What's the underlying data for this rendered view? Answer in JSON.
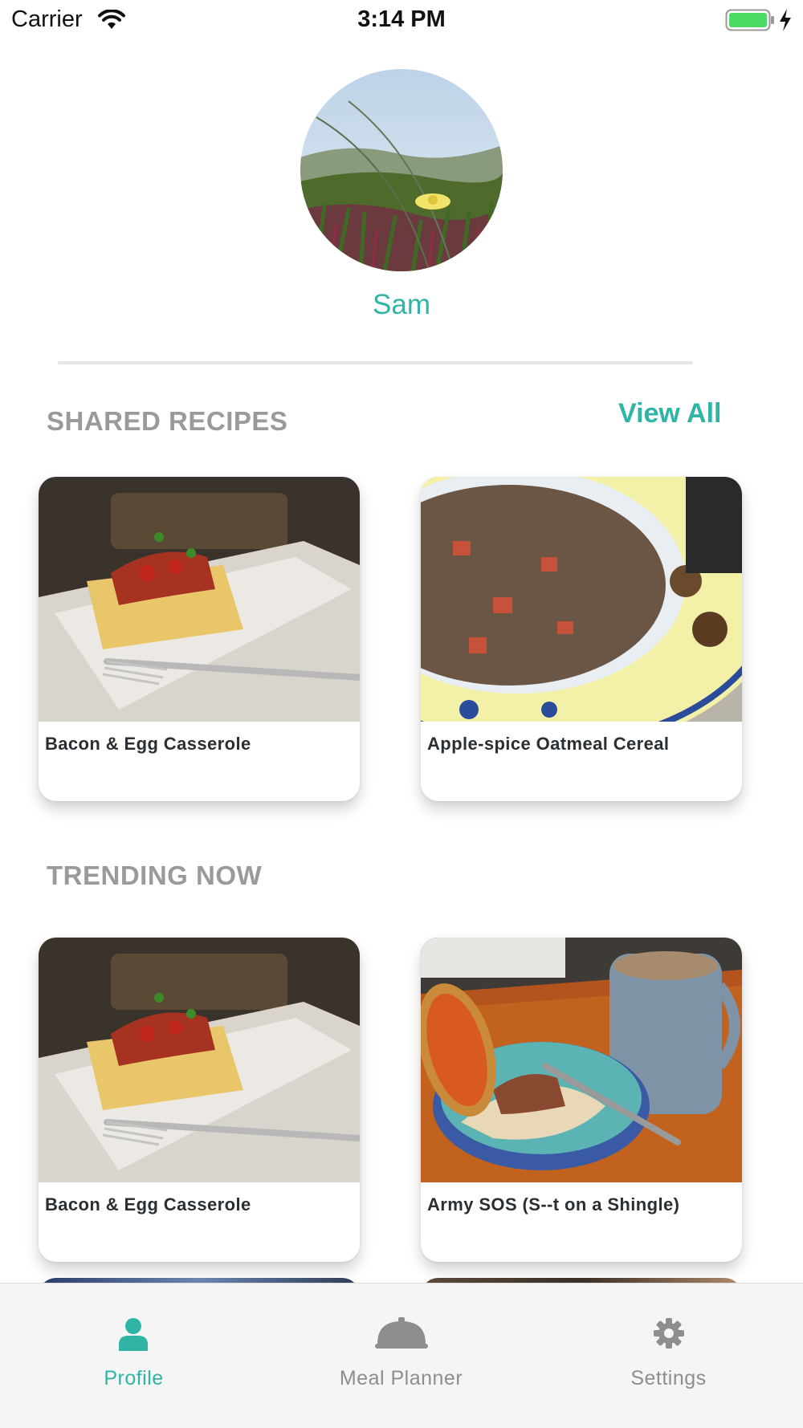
{
  "status_bar": {
    "carrier": "Carrier",
    "time": "3:14 PM"
  },
  "profile": {
    "name": "Sam"
  },
  "shared_recipes": {
    "title": "SHARED RECIPES",
    "view_all": "View All",
    "items": [
      {
        "title": "Bacon & Egg Casserole"
      },
      {
        "title": "Apple-spice Oatmeal Cereal"
      }
    ]
  },
  "trending_now": {
    "title": "TRENDING NOW",
    "items": [
      {
        "title": "Bacon & Egg Casserole"
      },
      {
        "title": "Army SOS (S--t on a Shingle)"
      }
    ]
  },
  "tab_bar": {
    "tabs": [
      {
        "label": "Profile",
        "icon": "person-icon",
        "active": true
      },
      {
        "label": "Meal Planner",
        "icon": "cloche-icon",
        "active": false
      },
      {
        "label": "Settings",
        "icon": "gear-icon",
        "active": false
      }
    ]
  },
  "colors": {
    "accent": "#2fb4a5",
    "section_title": "#9a9a9a",
    "tab_inactive": "#8e8e8e"
  }
}
